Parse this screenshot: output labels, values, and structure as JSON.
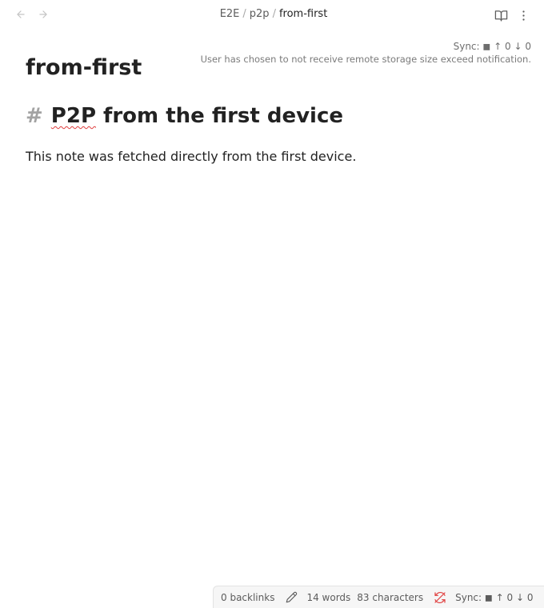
{
  "header": {
    "breadcrumb": [
      "E2E",
      "p2p"
    ],
    "current": "from-first"
  },
  "sync_overlay": {
    "status": "Sync: ◼ ↑ 0 ↓ 0",
    "notice": "User has chosen to not receive remote storage size exceed notification."
  },
  "note": {
    "title": "from-first",
    "heading_hash": "#",
    "heading_word": "P2P",
    "heading_rest": " from the first device",
    "paragraph": "This note was fetched directly from the first device."
  },
  "status_bar": {
    "backlinks": "0 backlinks",
    "words": "14 words",
    "characters": "83 characters",
    "sync": "Sync: ◼ ↑ 0 ↓ 0"
  },
  "icons": {
    "back": "arrow-left-icon",
    "forward": "arrow-right-icon",
    "reading": "book-open-icon",
    "more": "more-vertical-icon",
    "edit": "pencil-icon",
    "sync_off": "refresh-off-icon"
  },
  "colors": {
    "sync_error": "#e03e3e",
    "misspell": "#e03e3e"
  }
}
